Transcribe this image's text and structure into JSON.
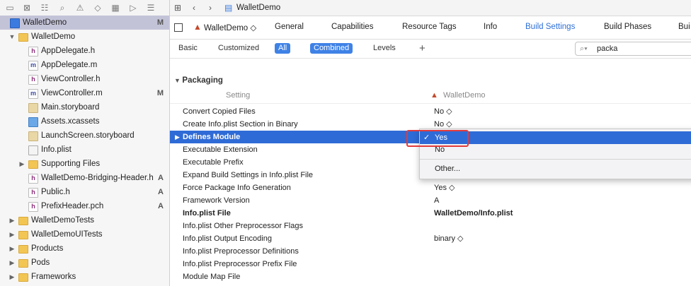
{
  "navigator": {
    "toolbar_icons": [
      "folder-icon",
      "source-control-icon",
      "symbol-icon",
      "find-icon",
      "issue-icon",
      "test-icon",
      "debug-icon",
      "breakpoint-icon",
      "report-icon"
    ],
    "items": [
      {
        "label": "WalletDemo",
        "badge": "M",
        "icon": "project-icon",
        "kind": "proj",
        "indent": 0,
        "disclosure": "",
        "selected": true
      },
      {
        "label": "WalletDemo",
        "badge": "",
        "icon": "folder-icon",
        "kind": "folder",
        "indent": 1,
        "disclosure": "▼",
        "selected": false
      },
      {
        "label": "AppDelegate.h",
        "badge": "",
        "icon": "header-file-icon",
        "kind": "h",
        "indent": 2,
        "disclosure": "",
        "selected": false
      },
      {
        "label": "AppDelegate.m",
        "badge": "",
        "icon": "source-file-icon",
        "kind": "m",
        "indent": 2,
        "disclosure": "",
        "selected": false
      },
      {
        "label": "ViewController.h",
        "badge": "",
        "icon": "header-file-icon",
        "kind": "h",
        "indent": 2,
        "disclosure": "",
        "selected": false
      },
      {
        "label": "ViewController.m",
        "badge": "M",
        "icon": "source-file-icon",
        "kind": "m",
        "indent": 2,
        "disclosure": "",
        "selected": false
      },
      {
        "label": "Main.storyboard",
        "badge": "",
        "icon": "storyboard-icon",
        "kind": "sb",
        "indent": 2,
        "disclosure": "",
        "selected": false
      },
      {
        "label": "Assets.xcassets",
        "badge": "",
        "icon": "asset-catalog-icon",
        "kind": "xc",
        "indent": 2,
        "disclosure": "",
        "selected": false
      },
      {
        "label": "LaunchScreen.storyboard",
        "badge": "",
        "icon": "storyboard-icon",
        "kind": "sb",
        "indent": 2,
        "disclosure": "",
        "selected": false
      },
      {
        "label": "Info.plist",
        "badge": "",
        "icon": "plist-icon",
        "kind": "pl",
        "indent": 2,
        "disclosure": "",
        "selected": false
      },
      {
        "label": "Supporting Files",
        "badge": "",
        "icon": "folder-icon",
        "kind": "folder",
        "indent": 2,
        "disclosure": "▶",
        "selected": false
      },
      {
        "label": "WalletDemo-Bridging-Header.h",
        "badge": "A",
        "icon": "header-file-icon",
        "kind": "h",
        "indent": 2,
        "disclosure": "",
        "selected": false
      },
      {
        "label": "Public.h",
        "badge": "A",
        "icon": "header-file-icon",
        "kind": "h",
        "indent": 2,
        "disclosure": "",
        "selected": false
      },
      {
        "label": "PrefixHeader.pch",
        "badge": "A",
        "icon": "header-file-icon",
        "kind": "h",
        "indent": 2,
        "disclosure": "",
        "selected": false
      },
      {
        "label": "WalletDemoTests",
        "badge": "",
        "icon": "folder-icon",
        "kind": "folder",
        "indent": 1,
        "disclosure": "▶",
        "selected": false
      },
      {
        "label": "WalletDemoUITests",
        "badge": "",
        "icon": "folder-icon",
        "kind": "folder",
        "indent": 1,
        "disclosure": "▶",
        "selected": false
      },
      {
        "label": "Products",
        "badge": "",
        "icon": "folder-icon",
        "kind": "folder",
        "indent": 1,
        "disclosure": "▶",
        "selected": false
      },
      {
        "label": "Pods",
        "badge": "",
        "icon": "folder-icon",
        "kind": "folder",
        "indent": 1,
        "disclosure": "▶",
        "selected": false
      },
      {
        "label": "Frameworks",
        "badge": "",
        "icon": "folder-icon",
        "kind": "folder",
        "indent": 1,
        "disclosure": "▶",
        "selected": false
      }
    ]
  },
  "jumpbar": {
    "file": "WalletDemo"
  },
  "tabs": {
    "target": "WalletDemo ◇",
    "items": [
      "General",
      "Capabilities",
      "Resource Tags",
      "Info",
      "Build Settings",
      "Build Phases",
      "Bui"
    ],
    "active": "Build Settings"
  },
  "scope": {
    "basic": "Basic",
    "customized": "Customized",
    "all": "All",
    "combined": "Combined",
    "levels": "Levels",
    "add": "+",
    "search_value": "packa"
  },
  "settings": {
    "group": "Packaging",
    "col_setting": "Setting",
    "col_target": "WalletDemo",
    "rows": [
      {
        "name": "Convert Copied Files",
        "value": "No ◇",
        "bold": false,
        "selected": false
      },
      {
        "name": "Create Info.plist Section in Binary",
        "value": "No ◇",
        "bold": false,
        "selected": false
      },
      {
        "name": "Defines Module",
        "value": "",
        "bold": true,
        "selected": true
      },
      {
        "name": "Executable Extension",
        "value": "",
        "bold": false,
        "selected": false
      },
      {
        "name": "Executable Prefix",
        "value": "",
        "bold": false,
        "selected": false
      },
      {
        "name": "Expand Build Settings in Info.plist File",
        "value": "",
        "bold": false,
        "selected": false
      },
      {
        "name": "Force Package Info Generation",
        "value": "Yes ◇",
        "bold": false,
        "selected": false
      },
      {
        "name": "Framework Version",
        "value": "A",
        "bold": false,
        "selected": false
      },
      {
        "name": "Info.plist File",
        "value": "WalletDemo/Info.plist",
        "bold": true,
        "selected": false
      },
      {
        "name": "Info.plist Other Preprocessor Flags",
        "value": "",
        "bold": false,
        "selected": false
      },
      {
        "name": "Info.plist Output Encoding",
        "value": "binary ◇",
        "bold": false,
        "selected": false
      },
      {
        "name": "Info.plist Preprocessor Definitions",
        "value": "",
        "bold": false,
        "selected": false
      },
      {
        "name": "Info.plist Preprocessor Prefix File",
        "value": "",
        "bold": false,
        "selected": false
      },
      {
        "name": "Module Map File",
        "value": "",
        "bold": false,
        "selected": false
      }
    ]
  },
  "popup": {
    "check": "✓",
    "items": [
      "Yes",
      "No",
      "Other..."
    ]
  },
  "colors": {
    "accent": "#2f6bd6",
    "highlight_box": "#e23b3b",
    "folder": "#f3c653"
  }
}
